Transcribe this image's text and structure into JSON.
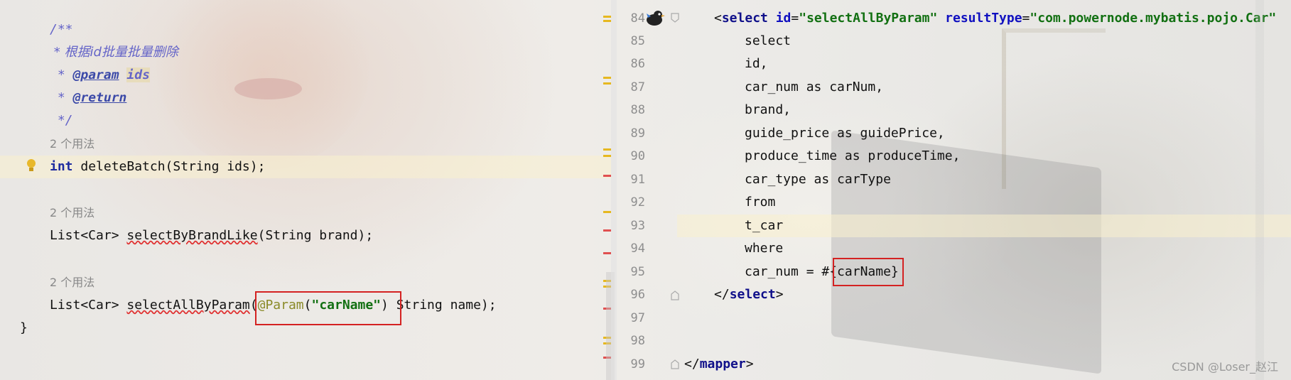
{
  "left_editor": {
    "lines": [
      {
        "kind": "doc_open",
        "text": "/**"
      },
      {
        "kind": "doc",
        "text": " * 根据id批量批量删除"
      },
      {
        "kind": "doc_param",
        "star": " * ",
        "tag": "@param",
        "name": "ids"
      },
      {
        "kind": "doc_return",
        "star": " * ",
        "tag": "@return"
      },
      {
        "kind": "doc_close",
        "text": " */"
      },
      {
        "kind": "usage",
        "text": "2 个用法"
      },
      {
        "kind": "method1",
        "kw": "int",
        "text": " deleteBatch(String ids);"
      },
      {
        "kind": "usage",
        "text": "2 个用法"
      },
      {
        "kind": "method2",
        "prefix": "List<Car> ",
        "name": "selectByBrandLike",
        "rest": "(String brand);"
      },
      {
        "kind": "usage",
        "text": "2 个用法"
      },
      {
        "kind": "method3",
        "prefix": "List<Car> ",
        "name": "selectAllByParam",
        "paren": "(",
        "anno": "@Param",
        "lp": "(",
        "str": "\"carName\"",
        "rp": ")",
        "rest": " String name);"
      },
      {
        "kind": "brace",
        "text": "}"
      }
    ]
  },
  "right_editor": {
    "line_numbers": [
      "84",
      "85",
      "86",
      "87",
      "88",
      "89",
      "90",
      "91",
      "92",
      "93",
      "94",
      "95",
      "96",
      "97",
      "98",
      "99"
    ],
    "select_open": {
      "lt": "<",
      "tag": "select",
      "attr1": "id",
      "v1": "\"selectAllByParam\"",
      "attr2": "resultType",
      "v2": "\"com.powernode.mybatis.pojo.Car\""
    },
    "sql_lines": [
      "select",
      "id,",
      "car_num as carNum,",
      "brand,",
      "guide_price as guidePrice,",
      "produce_time as produceTime,",
      "car_type as carType",
      "from",
      "t_car",
      "where"
    ],
    "where_line": {
      "prefix": "car_num = #",
      "param": "{carName}"
    },
    "select_close": {
      "lt": "</",
      "tag": "select",
      "gt": ">"
    },
    "mapper_close": {
      "lt": "</",
      "tag": "mapper",
      "gt": ">"
    }
  },
  "watermark": "CSDN @Loser_赵江",
  "icons": {
    "bulb": "lightbulb-icon",
    "mybatis": "mybatis-bird-icon",
    "fold": "fold-icon"
  }
}
